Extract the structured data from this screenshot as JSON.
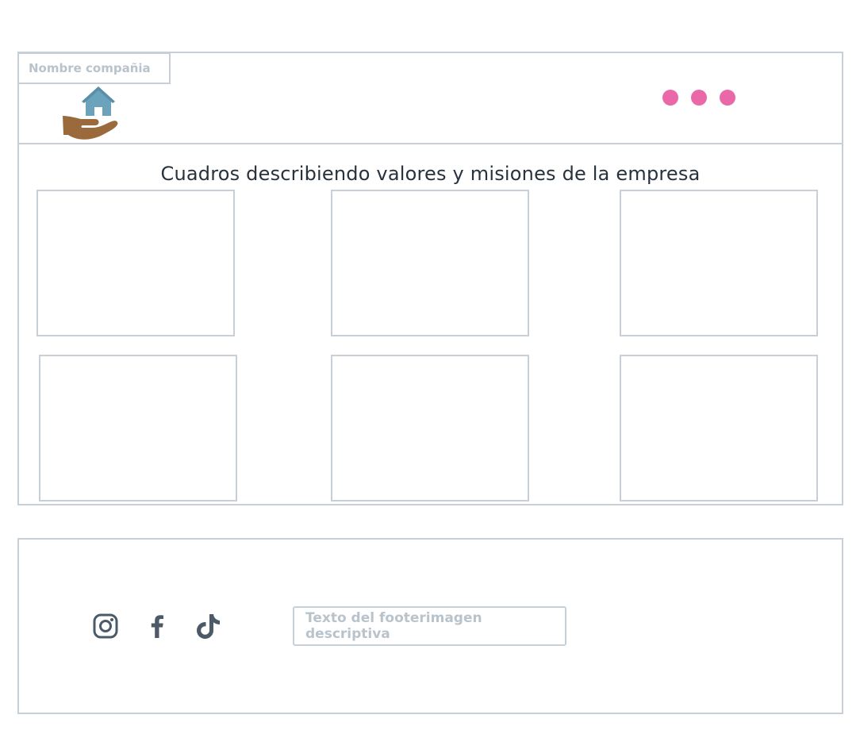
{
  "header": {
    "company_name": "Nombre compañia",
    "logo_icon": "hand-holding-house-icon",
    "menu_icon": "more-dots-icon",
    "dot_color": "#ea68a8"
  },
  "main": {
    "section_title": "Cuadros describiendo valores y misiones de la empresa",
    "cards": [
      {
        "name": "value-card-1"
      },
      {
        "name": "value-card-2"
      },
      {
        "name": "value-card-3"
      },
      {
        "name": "value-card-4"
      },
      {
        "name": "value-card-5"
      },
      {
        "name": "value-card-6"
      }
    ]
  },
  "footer": {
    "social_icons": [
      "instagram-icon",
      "facebook-icon",
      "tiktok-icon"
    ],
    "icon_color": "#4b5a66",
    "text": "Texto del footerimagen descriptiva"
  },
  "colors": {
    "border": "#c7d0d8",
    "placeholder_text": "#b9c3cc",
    "title_text": "#27323d",
    "house": "#6ba3bd",
    "hand": "#9b6a3c"
  }
}
